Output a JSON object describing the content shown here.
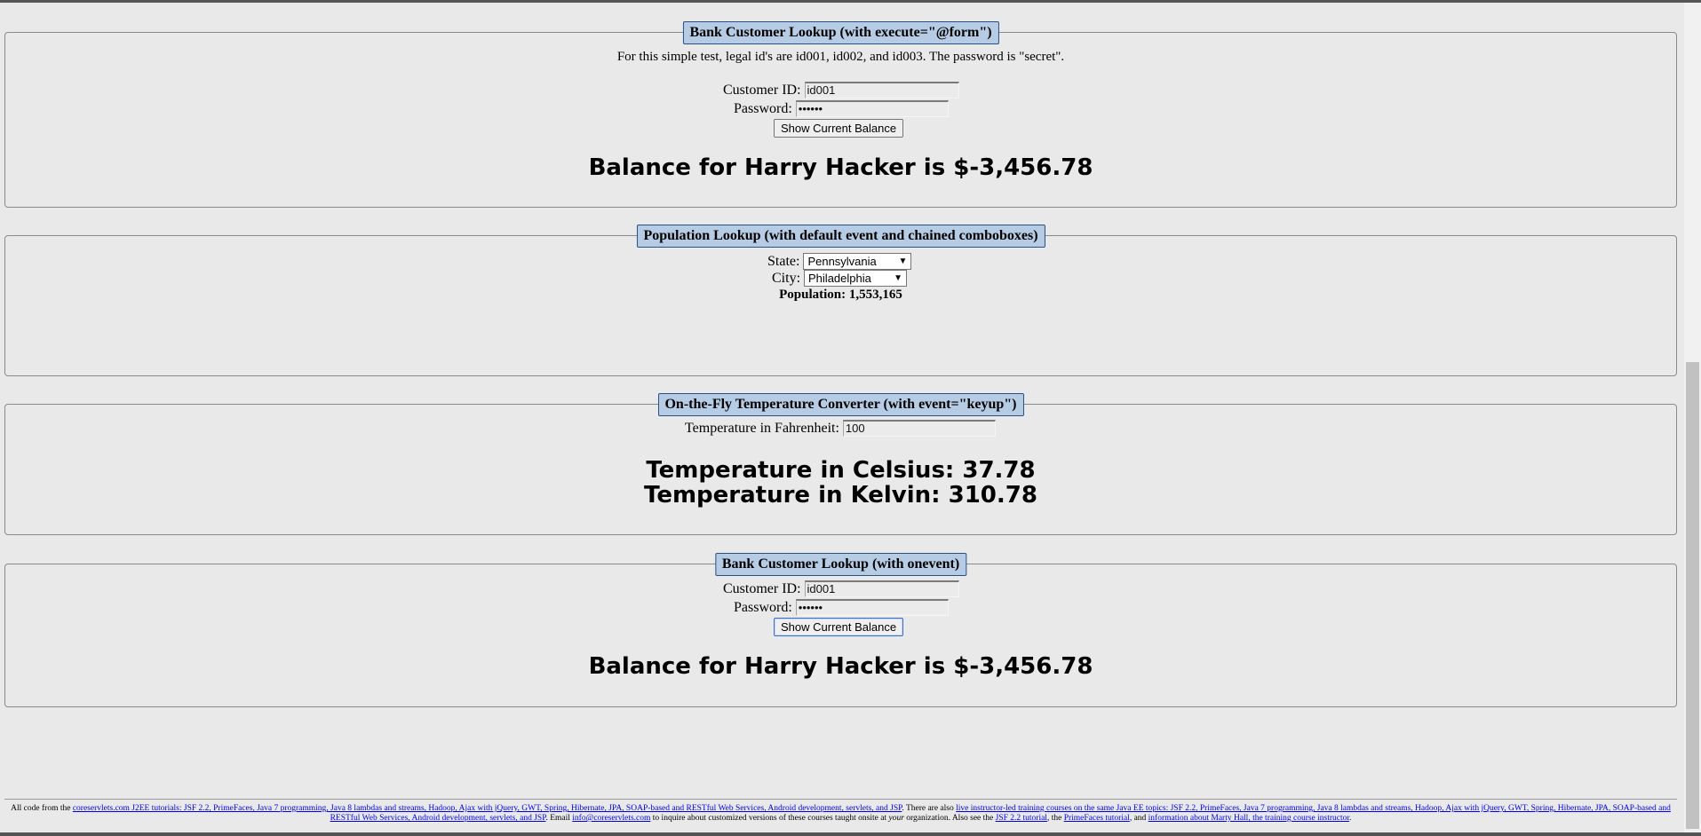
{
  "bank_form": {
    "legend": "Bank Customer Lookup (with execute=\"@form\")",
    "intro": "For this simple test, legal id's are id001, id002, and id003. The password is \"secret\".",
    "customer_id_label": "Customer ID:",
    "customer_id_value": "id001",
    "password_label": "Password:",
    "password_value": "••••••",
    "button_label": "Show Current Balance",
    "result": "Balance for Harry Hacker is $-3,456.78"
  },
  "population": {
    "legend": "Population Lookup (with default event and chained comboboxes)",
    "state_label": "State:",
    "state_value": "Pennsylvania",
    "city_label": "City:",
    "city_value": "Philadelphia",
    "result": "Population: 1,553,165"
  },
  "temperature": {
    "legend": "On-the-Fly Temperature Converter (with event=\"keyup\")",
    "fahrenheit_label": "Temperature in Fahrenheit:",
    "fahrenheit_value": "100",
    "celsius_result": "Temperature in Celsius: 37.78",
    "kelvin_result": "Temperature in Kelvin: 310.78"
  },
  "bank_onevent": {
    "legend": "Bank Customer Lookup (with onevent)",
    "customer_id_label": "Customer ID:",
    "customer_id_value": "id001",
    "password_label": "Password:",
    "password_value": "••••••",
    "button_label": "Show Current Balance",
    "result": "Balance for Harry Hacker is $-3,456.78"
  },
  "footer": {
    "t1": "All code from the ",
    "l1": "coreservlets.com J2EE tutorials: JSF 2.2, PrimeFaces, Java 7 programming, Java 8 lambdas and streams, Hadoop, Ajax with jQuery, GWT, Spring, Hibernate, JPA, SOAP-based and RESTful Web Services, Android development, servlets, and JSP",
    "t2": ". There are also ",
    "l2": "live instructor-led training courses on the same Java EE topics: JSF 2.2, PrimeFaces, Java 7 programming, Java 8 lambdas and streams, Hadoop, Ajax with jQuery, GWT, Spring, Hibernate, JPA, SOAP-based and RESTful Web Services, Android development, servlets, and JSP",
    "t3": ". Email ",
    "l3": "info@coreservlets.com",
    "t4": " to inquire about customized versions of these courses taught onsite at ",
    "t4_em": "your",
    "t5": " organization. Also see the ",
    "l4": "JSF 2.2 tutorial",
    "t6": ", the ",
    "l5": "PrimeFaces tutorial",
    "t7": ", and ",
    "l6": "information about Marty Hall, the training course instructor",
    "t8": "."
  },
  "colors": {
    "page_background": "#e9e9e9",
    "legend_background": "#b6cbe4",
    "legend_border": "#2a4f84",
    "link": "#0000ee"
  }
}
